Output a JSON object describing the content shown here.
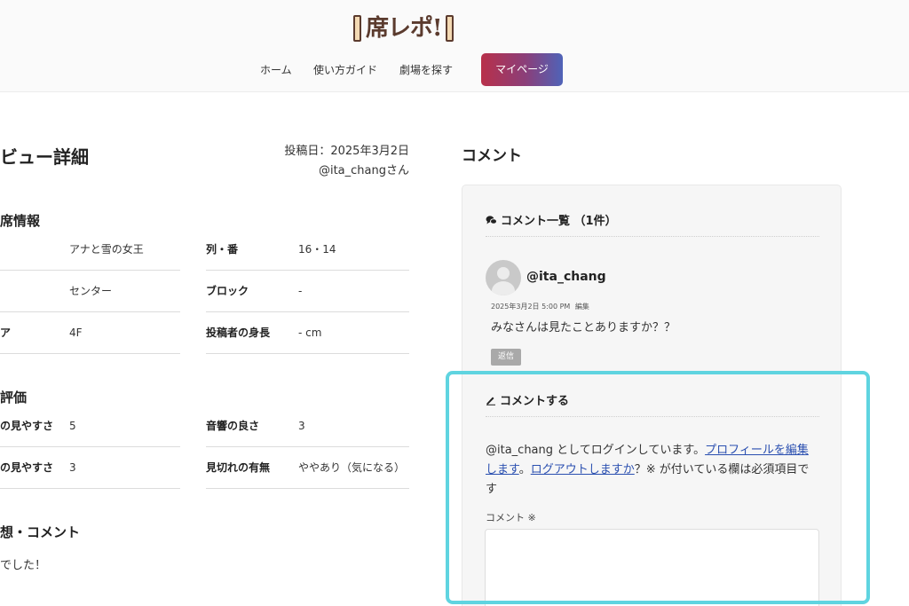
{
  "header": {
    "logo_text": "席レポ!",
    "nav": [
      {
        "label": "ホーム"
      },
      {
        "label": "使い方ガイド"
      },
      {
        "label": "劇場を探す"
      }
    ],
    "mypage_label": "マイページ"
  },
  "review": {
    "title": "ビュー詳細",
    "posted_date": "投稿日：2025年3月2日",
    "author": "@ita_changさん",
    "seat_section_title": "席情報",
    "seat_rows": [
      {
        "label": "",
        "value": "アナと雪の女王",
        "label2": "列・番",
        "value2": "16・14"
      },
      {
        "label": "",
        "value": "センター",
        "label2": "ブロック",
        "value2": "-"
      },
      {
        "label": "ア",
        "value": "4F",
        "label2": "投稿者の身長",
        "value2": "- cm"
      }
    ],
    "rating_section_title": "評価",
    "rating_rows": [
      {
        "label": "の見やすさ",
        "value": "5",
        "label2": "音響の良さ",
        "value2": "3"
      },
      {
        "label": "の見やすさ",
        "value": "3",
        "label2": "見切れの有無",
        "value2": "ややあり（気になる）"
      }
    ],
    "comment_section_title": "想・コメント",
    "comment_text": "でした！"
  },
  "comments": {
    "title": "コメント",
    "list_title": "コメント一覧 （1件）",
    "items": [
      {
        "username": "@ita_chang",
        "date": "2025年3月2日 5:00 PM",
        "edit_label": "編集",
        "text": "みなさんは見たことありますか？？",
        "reply_label": "返信"
      }
    ],
    "form": {
      "title": "コメントする",
      "logged_in_prefix": "@ita_chang としてログインしています。",
      "profile_link": "プロフィールを編集します",
      "sep": "。",
      "logout_link": "ログアウトしますか",
      "required_note": "？※ が付いている欄は必須項目です",
      "comment_label": "コメント ※",
      "comment_value": ""
    }
  },
  "colors": {
    "mypage_gradient_start": "#b8304a",
    "mypage_gradient_end": "#4f63b8",
    "highlight": "#5fd4e0",
    "link": "#2a4fb0"
  }
}
